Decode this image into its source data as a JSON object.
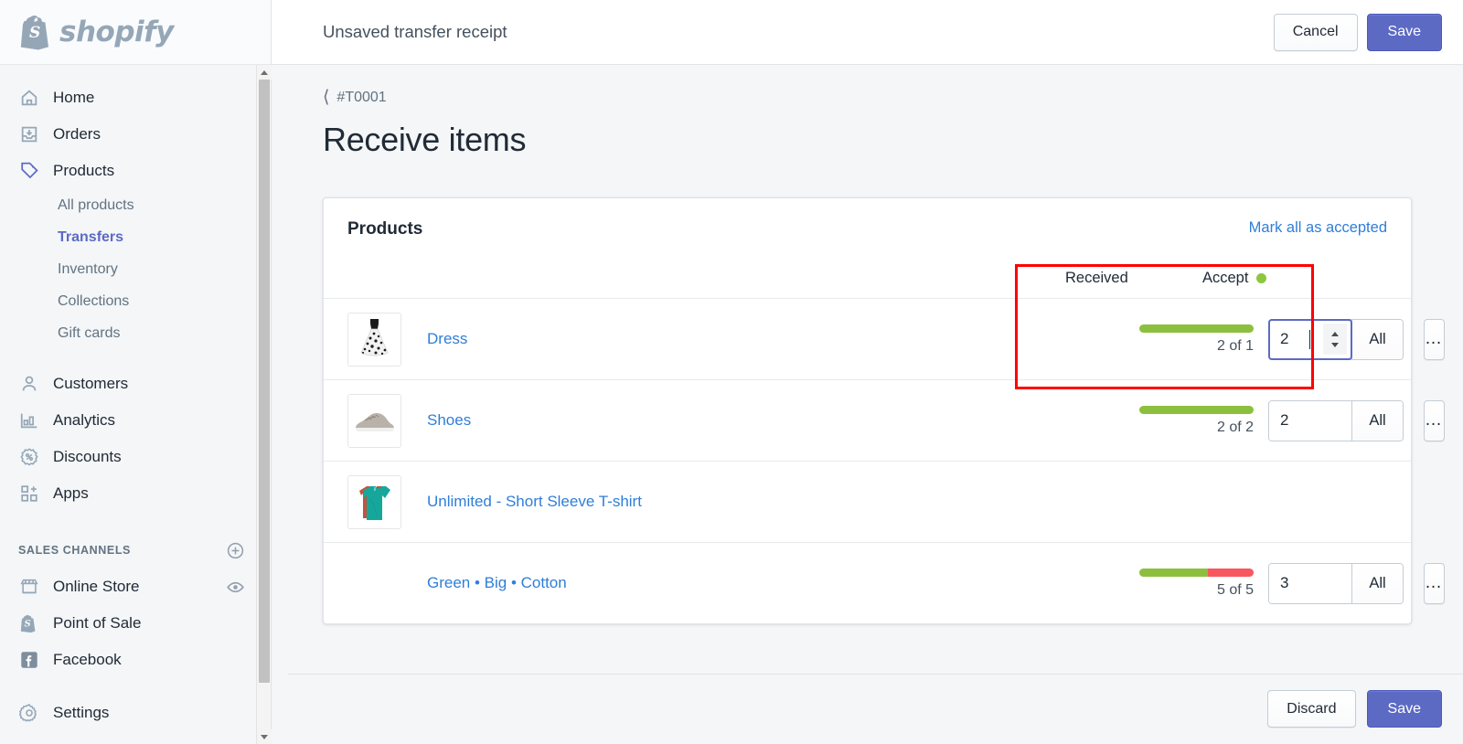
{
  "brand": {
    "name": "shopify",
    "logo_icon": "shopify-bag-icon"
  },
  "sidebar": {
    "items": [
      {
        "label": "Home",
        "icon": "home-icon",
        "type": "item"
      },
      {
        "label": "Orders",
        "icon": "orders-inbox-icon",
        "type": "item"
      },
      {
        "label": "Products",
        "icon": "products-tag-icon",
        "type": "item",
        "active": true
      },
      {
        "label": "All products",
        "type": "sub"
      },
      {
        "label": "Transfers",
        "type": "sub",
        "active": true
      },
      {
        "label": "Inventory",
        "type": "sub"
      },
      {
        "label": "Collections",
        "type": "sub"
      },
      {
        "label": "Gift cards",
        "type": "sub"
      },
      {
        "label": "Customers",
        "icon": "customer-person-icon",
        "type": "item"
      },
      {
        "label": "Analytics",
        "icon": "analytics-bars-icon",
        "type": "item"
      },
      {
        "label": "Discounts",
        "icon": "discount-percent-icon",
        "type": "item"
      },
      {
        "label": "Apps",
        "icon": "apps-grid-plus-icon",
        "type": "item"
      }
    ],
    "section": {
      "title": "SALES CHANNELS",
      "add_icon": "plus-circle-icon"
    },
    "channels": [
      {
        "label": "Online Store",
        "icon": "store-icon",
        "trailing_icon": "eye-icon"
      },
      {
        "label": "Point of Sale",
        "icon": "pos-bag-icon"
      },
      {
        "label": "Facebook",
        "icon": "facebook-icon"
      }
    ],
    "settings": {
      "label": "Settings",
      "icon": "gear-icon"
    },
    "scrollbar": {
      "up_icon": "scroll-up-arrow",
      "down_icon": "scroll-down-arrow"
    }
  },
  "topbar": {
    "title": "Unsaved transfer receipt",
    "cancel_label": "Cancel",
    "save_label": "Save"
  },
  "page": {
    "breadcrumb": {
      "label": "#T0001",
      "back_icon": "chevron-left-icon"
    },
    "title": "Receive items"
  },
  "card": {
    "title": "Products",
    "mark_all_label": "Mark all as accepted",
    "columns": {
      "received": "Received",
      "accept": "Accept",
      "accept_status_icon": "green-status-dot"
    },
    "rows": [
      {
        "name": "Dress",
        "thumb_icon": "dress-thumbnail",
        "has_thumb": true,
        "received_label": "2 of 1",
        "bar": {
          "green_pct": 100,
          "red_pct": 0
        },
        "accept_value": "2",
        "all_label": "All",
        "more_icon": "ellipsis-icon",
        "focused": true,
        "has_spinner": true
      },
      {
        "name": "Shoes",
        "thumb_icon": "shoe-thumbnail",
        "has_thumb": true,
        "received_label": "2 of 2",
        "bar": {
          "green_pct": 100,
          "red_pct": 0
        },
        "accept_value": "2",
        "all_label": "All",
        "more_icon": "ellipsis-icon",
        "focused": false,
        "has_spinner": false
      },
      {
        "name": "Unlimited - Short Sleeve T-shirt",
        "thumb_icon": "tshirt-thumbnail",
        "has_thumb": true,
        "received_label": "",
        "bar": null,
        "accept_value": "",
        "all_label": "",
        "more_icon": "",
        "focused": false,
        "has_spinner": false,
        "header_only": true
      },
      {
        "name": "Green • Big • Cotton",
        "thumb_icon": "",
        "has_thumb": false,
        "received_label": "5 of 5",
        "bar": {
          "green_pct": 60,
          "red_pct": 40
        },
        "accept_value": "3",
        "all_label": "All",
        "more_icon": "ellipsis-icon",
        "focused": false,
        "has_spinner": false
      }
    ]
  },
  "footer": {
    "discard_label": "Discard",
    "save_label": "Save"
  },
  "colors": {
    "brand_purple": "#5c6ac4",
    "link_blue": "#2f7ed8",
    "progress_green": "#8dbf3f",
    "progress_red": "#f8575f",
    "status_dot_green": "#8dc63f",
    "highlight_red": "#ff0000",
    "page_bg": "#f4f6f8"
  }
}
